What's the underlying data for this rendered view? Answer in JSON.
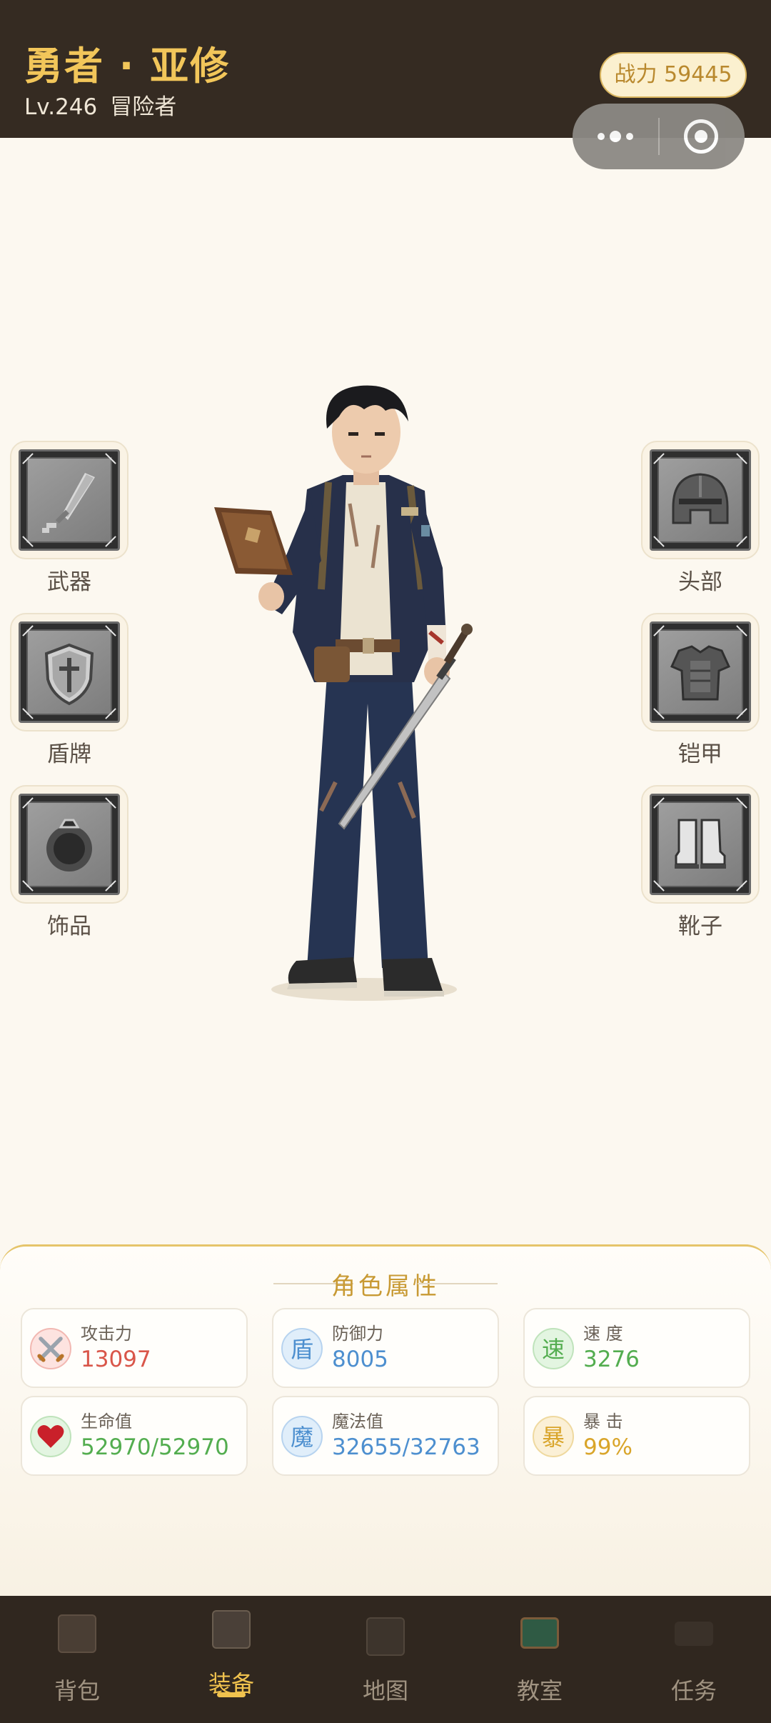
{
  "header": {
    "hero_name": "勇者 · 亚修",
    "level": "Lv.246",
    "role": "冒险者",
    "power_label": "战力 59445"
  },
  "equipment": {
    "left": [
      {
        "id": "weapon",
        "label": "武器",
        "icon": "sword-icon"
      },
      {
        "id": "shield",
        "label": "盾牌",
        "icon": "shield-icon"
      },
      {
        "id": "accessory",
        "label": "饰品",
        "icon": "ring-icon"
      }
    ],
    "right": [
      {
        "id": "head",
        "label": "头部",
        "icon": "helmet-icon"
      },
      {
        "id": "armor",
        "label": "铠甲",
        "icon": "armor-icon"
      },
      {
        "id": "boots",
        "label": "靴子",
        "icon": "boots-icon"
      }
    ]
  },
  "stats": {
    "title": "角色属性",
    "items": [
      {
        "label": "攻击力",
        "value": "13097",
        "icon": "crossed-swords-icon",
        "color": "#d9564a"
      },
      {
        "label": "防御力",
        "value": "8005",
        "icon_text": "盾",
        "color": "#4d8fcf"
      },
      {
        "label": "速 度",
        "value": "3276",
        "icon_text": "速",
        "color": "#53ad4f"
      },
      {
        "label": "生命值",
        "value": "52970/52970",
        "icon": "heart-icon",
        "color": "#53ad4f"
      },
      {
        "label": "魔法值",
        "value": "32655/32763",
        "icon_text": "魔",
        "color": "#4d8fcf"
      },
      {
        "label": "暴 击",
        "value": "99%",
        "icon_text": "暴",
        "color": "#d9a52a"
      }
    ]
  },
  "nav": {
    "items": [
      {
        "label": "背包",
        "active": false
      },
      {
        "label": "装备",
        "active": true
      },
      {
        "label": "地图",
        "active": false
      },
      {
        "label": "教室",
        "active": false
      },
      {
        "label": "任务",
        "active": false
      }
    ],
    "accent": "#f0c24e"
  }
}
